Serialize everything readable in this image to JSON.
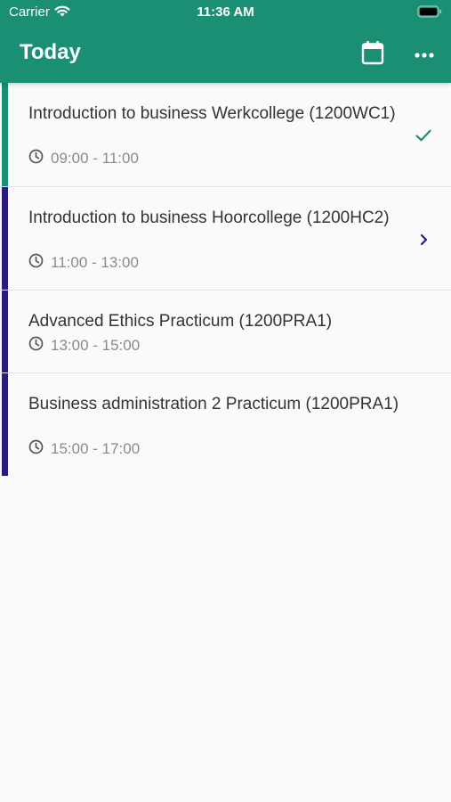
{
  "status_bar": {
    "carrier": "Carrier",
    "time": "11:36 AM"
  },
  "toolbar": {
    "title": "Today",
    "actions": [
      "calendar-icon",
      "more-horizontal-icon"
    ]
  },
  "colors": {
    "primary": "#1a8f73",
    "indigo": "#2a1b7c",
    "check": "#1a8f73"
  },
  "events": [
    {
      "title": "Introduction to business  Werkcollege (1200WC1)",
      "time": "09:00 - 11:00",
      "status": "completed",
      "trailing_icon": "check-icon"
    },
    {
      "title": "Introduction to business  Hoorcollege (1200HC2)",
      "time": "11:00 - 13:00",
      "status": "current",
      "trailing_icon": "chevron-right-icon"
    },
    {
      "title": "Advanced Ethics Practicum (1200PRA1)",
      "time": "13:00 - 15:00",
      "status": "upcoming",
      "trailing_icon": ""
    },
    {
      "title": "Business administration 2 Practicum (1200PRA1)",
      "time": "15:00 - 17:00",
      "status": "upcoming",
      "trailing_icon": ""
    }
  ]
}
